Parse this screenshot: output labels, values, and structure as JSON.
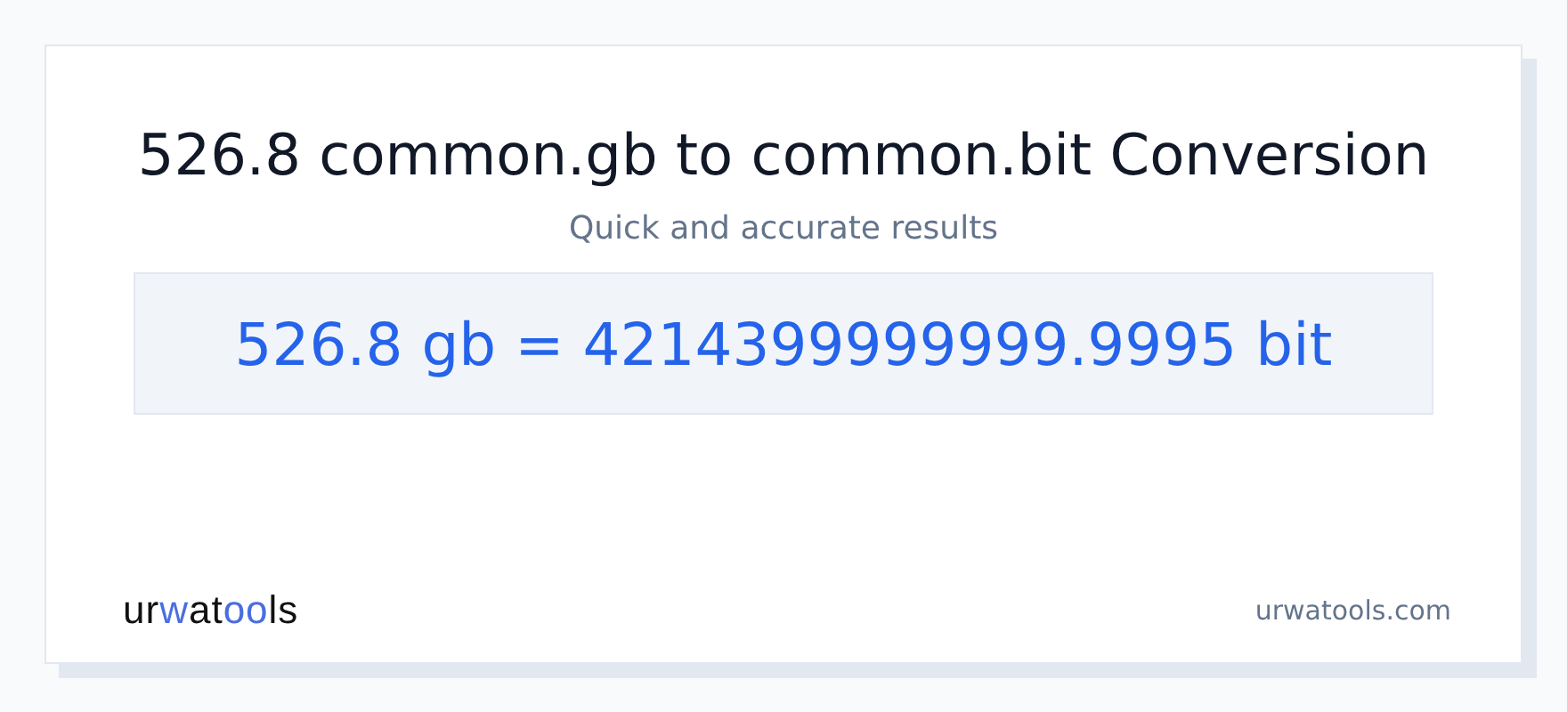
{
  "title": "526.8 common.gb to common.bit Conversion",
  "subtitle": "Quick and accurate results",
  "result": "526.8 gb = 4214399999999.9995 bit",
  "logo": [
    {
      "text": "ur",
      "accent": false
    },
    {
      "text": "w",
      "accent": true
    },
    {
      "text": "at",
      "accent": false
    },
    {
      "text": "oo",
      "accent": true
    },
    {
      "text": "ls",
      "accent": false
    }
  ],
  "domain": "urwatools.com"
}
